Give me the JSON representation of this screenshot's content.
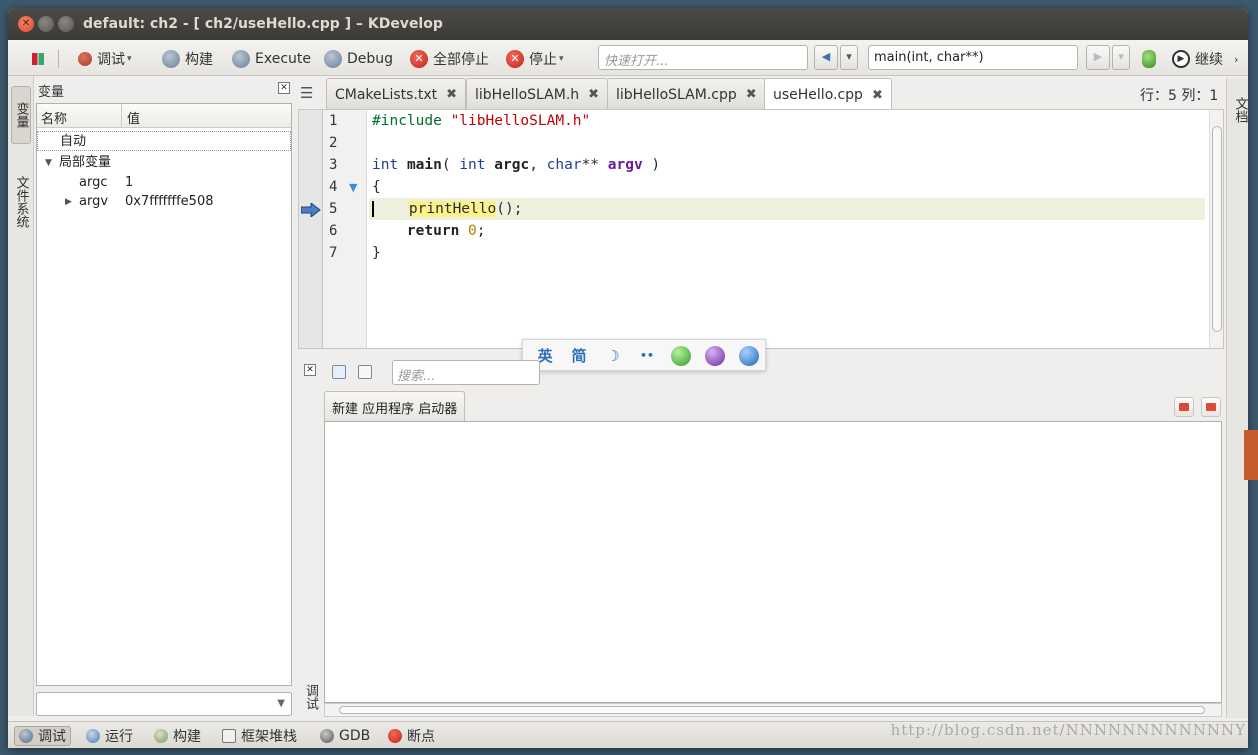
{
  "window": {
    "title": "default:  ch2 - [ ch2/useHello.cpp ] – KDevelop"
  },
  "toolbar": {
    "debug_label": "调试",
    "build_label": "构建",
    "execute_label": "Execute",
    "debug_run_label": "Debug",
    "stop_all_label": "全部停止",
    "stop_label": "停止",
    "quick_open_placeholder": "快速打开...",
    "context_value": "main(int, char**)",
    "continue_label": "继续"
  },
  "left_tabs": {
    "variables": "变量",
    "filesystem": "文件系统"
  },
  "right_tabs": {
    "documents": "文档"
  },
  "variables_panel": {
    "title": "变量",
    "col_name": "名称",
    "col_value": "值",
    "auto_label": "自动",
    "locals_label": "局部变量",
    "rows": [
      {
        "name": "argc",
        "value": "1"
      },
      {
        "name": "argv",
        "value": "0x7fffffffe508"
      }
    ]
  },
  "editor": {
    "tabs": [
      {
        "label": "CMakeLists.txt",
        "active": false
      },
      {
        "label": "libHelloSLAM.h",
        "active": false
      },
      {
        "label": "libHelloSLAM.cpp",
        "active": false
      },
      {
        "label": "useHello.cpp",
        "active": true
      }
    ],
    "cursor_position": "行：5 列：1",
    "line_numbers": [
      "1",
      "2",
      "3",
      "4",
      "5",
      "6",
      "7"
    ],
    "current_line": 5
  },
  "ime": {
    "lang": "英",
    "mode": "简"
  },
  "bottom": {
    "search_placeholder": "搜索...",
    "tab_label": "新建 应用程序 启动器",
    "side_label": "调试"
  },
  "statusbar": {
    "items": [
      {
        "label": "调试"
      },
      {
        "label": "运行"
      },
      {
        "label": "构建"
      },
      {
        "label": "框架堆栈"
      },
      {
        "label": "GDB"
      },
      {
        "label": "断点"
      }
    ]
  },
  "watermark": "http://blog.csdn.net/NNNNNNNNNNNNY",
  "colors": {
    "accent": "#3b8fd6",
    "current_line_bg": "#f0f0de",
    "highlight": "#f8f38a"
  }
}
